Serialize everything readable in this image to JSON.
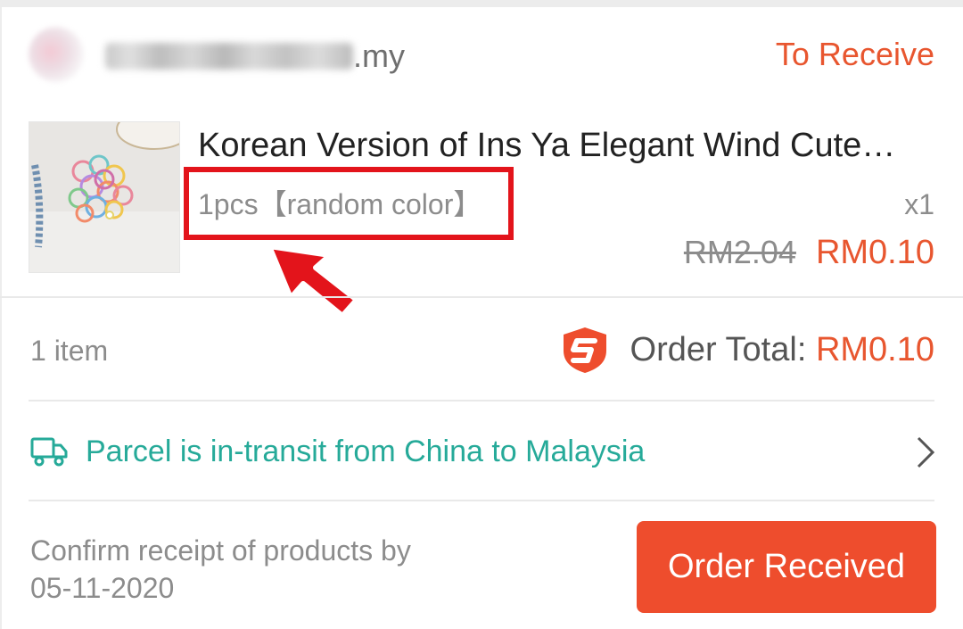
{
  "shop": {
    "name_suffix": ".my",
    "status": "To Receive"
  },
  "product": {
    "title": "Korean Version of Ins Ya Elegant Wind Cute…",
    "variation": "1pcs【random color】",
    "quantity": "x1",
    "original_price": "RM2.04",
    "price": "RM0.10"
  },
  "summary": {
    "item_count": "1 item",
    "order_total_label": "Order Total: ",
    "order_total_value": "RM0.10"
  },
  "shipping": {
    "status_text": "Parcel is in-transit from China to Malaysia"
  },
  "footer": {
    "confirm_line1": "Confirm receipt of products by",
    "confirm_date": "05-11-2020",
    "button_label": "Order Received"
  },
  "colors": {
    "accent": "#ee4d2d",
    "status_text": "#e8562f",
    "shipping_text": "#26aa99",
    "annotation": "#e3141b"
  },
  "icons": {
    "shop_avatar": "shop-avatar",
    "protection": "shield-icon",
    "shipping": "truck-icon",
    "navigation": "chevron-right-icon",
    "annotation": "arrow-pointer-icon"
  }
}
